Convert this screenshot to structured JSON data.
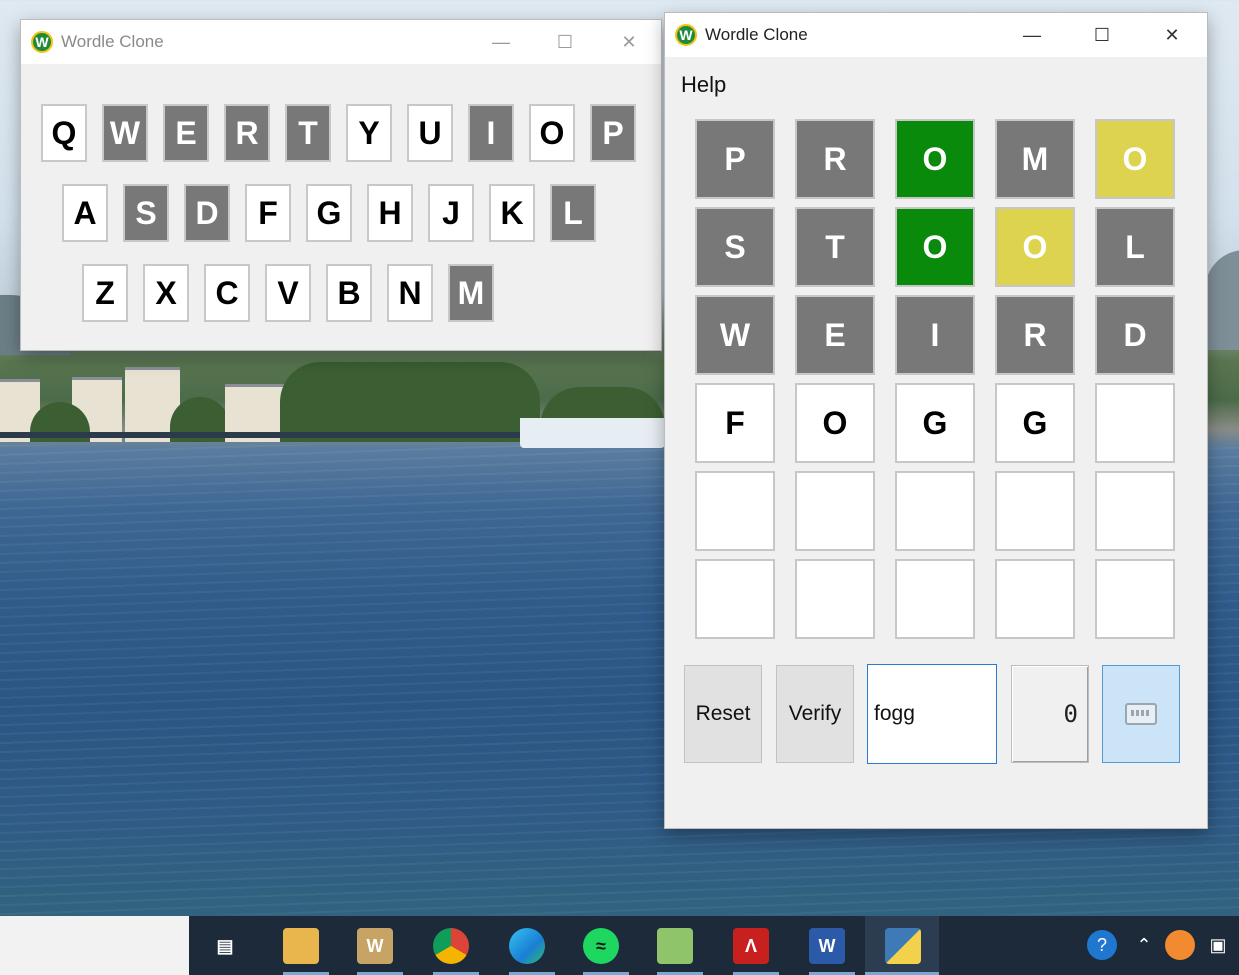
{
  "keyboard_window": {
    "title": "Wordle Clone",
    "rows": [
      [
        {
          "letter": "Q",
          "state": "unused"
        },
        {
          "letter": "W",
          "state": "absent"
        },
        {
          "letter": "E",
          "state": "absent"
        },
        {
          "letter": "R",
          "state": "absent"
        },
        {
          "letter": "T",
          "state": "absent"
        },
        {
          "letter": "Y",
          "state": "unused"
        },
        {
          "letter": "U",
          "state": "unused"
        },
        {
          "letter": "I",
          "state": "absent"
        },
        {
          "letter": "O",
          "state": "unused"
        },
        {
          "letter": "P",
          "state": "absent"
        }
      ],
      [
        {
          "letter": "A",
          "state": "unused"
        },
        {
          "letter": "S",
          "state": "absent"
        },
        {
          "letter": "D",
          "state": "absent"
        },
        {
          "letter": "F",
          "state": "unused"
        },
        {
          "letter": "G",
          "state": "unused"
        },
        {
          "letter": "H",
          "state": "unused"
        },
        {
          "letter": "J",
          "state": "unused"
        },
        {
          "letter": "K",
          "state": "unused"
        },
        {
          "letter": "L",
          "state": "absent"
        }
      ],
      [
        {
          "letter": "Z",
          "state": "unused"
        },
        {
          "letter": "X",
          "state": "unused"
        },
        {
          "letter": "C",
          "state": "unused"
        },
        {
          "letter": "V",
          "state": "unused"
        },
        {
          "letter": "B",
          "state": "unused"
        },
        {
          "letter": "N",
          "state": "unused"
        },
        {
          "letter": "M",
          "state": "absent"
        }
      ]
    ]
  },
  "game_window": {
    "title": "Wordle Clone",
    "menu": [
      "Help"
    ],
    "board": [
      [
        {
          "l": "P",
          "s": "absent"
        },
        {
          "l": "R",
          "s": "absent"
        },
        {
          "l": "O",
          "s": "correct"
        },
        {
          "l": "M",
          "s": "absent"
        },
        {
          "l": "O",
          "s": "present"
        }
      ],
      [
        {
          "l": "S",
          "s": "absent"
        },
        {
          "l": "T",
          "s": "absent"
        },
        {
          "l": "O",
          "s": "correct"
        },
        {
          "l": "O",
          "s": "present"
        },
        {
          "l": "L",
          "s": "absent"
        }
      ],
      [
        {
          "l": "W",
          "s": "absent"
        },
        {
          "l": "E",
          "s": "absent"
        },
        {
          "l": "I",
          "s": "absent"
        },
        {
          "l": "R",
          "s": "absent"
        },
        {
          "l": "D",
          "s": "absent"
        }
      ],
      [
        {
          "l": "F",
          "s": "empty"
        },
        {
          "l": "O",
          "s": "empty"
        },
        {
          "l": "G",
          "s": "empty"
        },
        {
          "l": "G",
          "s": "empty"
        },
        {
          "l": "",
          "s": "empty"
        }
      ],
      [
        {
          "l": "",
          "s": "empty"
        },
        {
          "l": "",
          "s": "empty"
        },
        {
          "l": "",
          "s": "empty"
        },
        {
          "l": "",
          "s": "empty"
        },
        {
          "l": "",
          "s": "empty"
        }
      ],
      [
        {
          "l": "",
          "s": "empty"
        },
        {
          "l": "",
          "s": "empty"
        },
        {
          "l": "",
          "s": "empty"
        },
        {
          "l": "",
          "s": "empty"
        },
        {
          "l": "",
          "s": "empty"
        }
      ]
    ],
    "reset_label": "Reset",
    "verify_label": "Verify",
    "guess_input_value": "fogg",
    "counter_value": "0"
  },
  "colors": {
    "absent": "#787878",
    "correct": "#0a8a0a",
    "present": "#ddd34e",
    "empty": "#ffffff"
  },
  "taskbar": {
    "icons": [
      "task-view-icon",
      "file-explorer-icon",
      "word-legacy-icon",
      "chrome-icon",
      "edge-icon",
      "spotify-icon",
      "notepad-plus-icon",
      "acrobat-icon",
      "word-icon",
      "python-icon"
    ],
    "tray": [
      "help-icon",
      "chevron-up-icon",
      "weather-icon",
      "meet-now-icon"
    ]
  }
}
